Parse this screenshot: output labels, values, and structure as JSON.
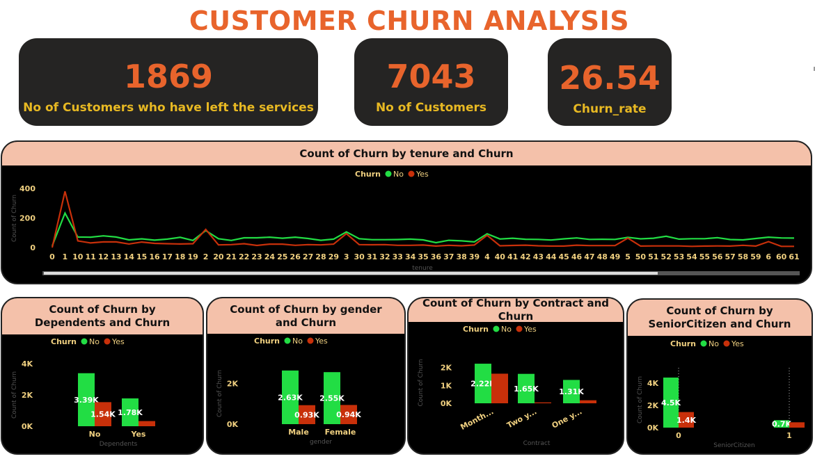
{
  "title": "CUSTOMER CHURN ANALYSIS",
  "kpis": [
    {
      "value": "1869",
      "label": "No of Customers who have left the services"
    },
    {
      "value": "7043",
      "label": "No of Customers"
    },
    {
      "value": "26.54",
      "label": "Churn_rate"
    }
  ],
  "colors": {
    "no": "#22dd44",
    "yes": "#c8300a",
    "accent": "#e8642c",
    "label": "#e8b923",
    "header": "#f4c1aa",
    "tick": "#f0d080"
  },
  "legend": {
    "title": "Churn",
    "no": "No",
    "yes": "Yes"
  },
  "chart_data": [
    {
      "type": "line",
      "title": "Count of Churn by tenure and Churn",
      "xlabel": "tenure",
      "ylabel": "Count of Churn",
      "ylim": [
        0,
        400
      ],
      "yticks": [
        "0",
        "200",
        "400"
      ],
      "x": [
        "0",
        "1",
        "10",
        "11",
        "12",
        "13",
        "14",
        "15",
        "16",
        "17",
        "18",
        "19",
        "2",
        "20",
        "21",
        "22",
        "23",
        "24",
        "25",
        "26",
        "27",
        "28",
        "29",
        "3",
        "30",
        "31",
        "32",
        "33",
        "34",
        "35",
        "36",
        "37",
        "38",
        "39",
        "4",
        "40",
        "41",
        "42",
        "43",
        "44",
        "45",
        "46",
        "47",
        "48",
        "49",
        "5",
        "50",
        "51",
        "52",
        "53",
        "54",
        "55",
        "56",
        "57",
        "58",
        "59",
        "6",
        "60",
        "61"
      ],
      "series": [
        {
          "name": "No",
          "values": [
            11,
            233,
            71,
            70,
            79,
            71,
            52,
            59,
            50,
            57,
            69,
            48,
            115,
            60,
            48,
            66,
            66,
            70,
            63,
            70,
            61,
            49,
            57,
            106,
            60,
            53,
            53,
            54,
            57,
            52,
            33,
            49,
            45,
            38,
            93,
            58,
            63,
            56,
            55,
            51,
            59,
            65,
            55,
            56,
            55,
            69,
            59,
            63,
            76,
            57,
            60,
            60,
            67,
            54,
            52,
            61,
            70,
            65,
            64
          ]
        },
        {
          "name": "Yes",
          "values": [
            0,
            380,
            45,
            31,
            38,
            38,
            24,
            37,
            28,
            26,
            24,
            26,
            123,
            18,
            20,
            26,
            14,
            23,
            23,
            15,
            20,
            18,
            23,
            94,
            20,
            19,
            20,
            15,
            15,
            17,
            10,
            15,
            12,
            17,
            83,
            12,
            14,
            16,
            12,
            10,
            10,
            16,
            13,
            13,
            13,
            64,
            10,
            11,
            11,
            11,
            8,
            10,
            11,
            10,
            15,
            10,
            40,
            8,
            8
          ]
        }
      ]
    },
    {
      "type": "bar",
      "title": "Count of Churn by Dependents and Churn",
      "xlabel": "Dependents",
      "ylabel": "Count of Churn",
      "ylim": [
        0,
        4000
      ],
      "yticks": [
        "0K",
        "2K",
        "4K"
      ],
      "categories": [
        "No",
        "Yes"
      ],
      "series": [
        {
          "name": "No",
          "values": [
            3390,
            1780
          ],
          "labels": [
            "3.39K",
            "1.78K"
          ]
        },
        {
          "name": "Yes",
          "values": [
            1540,
            330
          ],
          "labels": [
            "1.54K",
            ""
          ]
        }
      ]
    },
    {
      "type": "bar",
      "title": "Count of Churn by gender and Churn",
      "xlabel": "gender",
      "ylabel": "Count of Churn",
      "ylim": [
        0,
        3000
      ],
      "yticks": [
        "0K",
        "2K"
      ],
      "categories": [
        "Male",
        "Female"
      ],
      "series": [
        {
          "name": "No",
          "values": [
            2630,
            2550
          ],
          "labels": [
            "2.63K",
            "2.55K"
          ]
        },
        {
          "name": "Yes",
          "values": [
            930,
            940
          ],
          "labels": [
            "0.93K",
            "0.94K"
          ]
        }
      ]
    },
    {
      "type": "bar",
      "title": "Count of Churn by Contract and Churn",
      "xlabel": "Contract",
      "ylabel": "Count of Churn",
      "ylim": [
        0,
        2300
      ],
      "yticks": [
        "0K",
        "1K",
        "2K"
      ],
      "categories": [
        "Month...",
        "Two y...",
        "One y..."
      ],
      "series": [
        {
          "name": "No",
          "values": [
            2220,
            1650,
            1310
          ],
          "labels": [
            "2.22K",
            "1.65K",
            "1.31K"
          ]
        },
        {
          "name": "Yes",
          "values": [
            1660,
            50,
            170
          ],
          "labels": [
            "",
            "",
            ""
          ]
        }
      ]
    },
    {
      "type": "bar",
      "title": "Count of Churn by SeniorCitizen and Churn",
      "xlabel": "SeniorCitizen",
      "ylabel": "Count of Churn",
      "ylim": [
        0,
        5000
      ],
      "yticks": [
        "0K",
        "2K",
        "4K"
      ],
      "categories": [
        "0",
        "1"
      ],
      "series": [
        {
          "name": "No",
          "values": [
            4500,
            670
          ],
          "labels": [
            "4.5K",
            "0.7K"
          ]
        },
        {
          "name": "Yes",
          "values": [
            1400,
            480
          ],
          "labels": [
            "1.4K",
            ""
          ]
        }
      ]
    }
  ]
}
